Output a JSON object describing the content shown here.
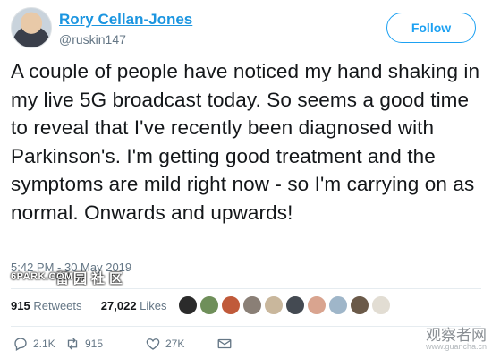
{
  "author": {
    "name": "Rory Cellan-Jones",
    "handle": "@ruskin147"
  },
  "follow_label": "Follow",
  "tweet": {
    "text": "A couple of people have noticed my hand shaking in my live 5G broadcast today. So seems a good time to reveal that I've recently been diagnosed with Parkinson's. I'm getting good treatment and the symptoms are mild right now - so I'm carrying on as normal. Onwards and upwards!",
    "timestamp": "5:42 PM - 30 May 2019"
  },
  "stats": {
    "retweets_count": "915",
    "retweets_label": "Retweets",
    "likes_count": "27,022",
    "likes_label": "Likes"
  },
  "actions": {
    "reply_count": "2.1K",
    "retweet_count": "915",
    "like_count": "27K"
  },
  "watermarks": {
    "left_cn": "留园社区",
    "left_site": "6PARK.COM",
    "right_cn": "观察者网",
    "right_site": "www.guancha.cn"
  },
  "colors": {
    "accent": "#1da1f2",
    "name": "#1b95e0",
    "muted": "#657786",
    "text": "#14171a"
  },
  "likers_avatars": [
    "liker-1",
    "liker-2",
    "liker-3",
    "liker-4",
    "liker-5",
    "liker-6",
    "liker-7",
    "liker-8",
    "liker-9",
    "liker-10"
  ]
}
